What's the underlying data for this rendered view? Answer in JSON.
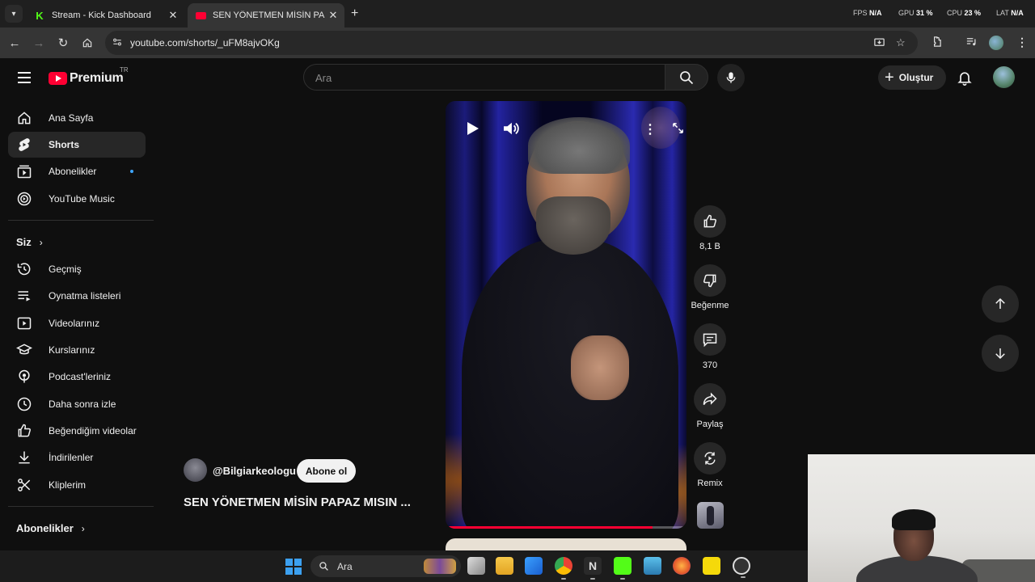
{
  "browser": {
    "tabs": [
      {
        "title": "Stream - Kick Dashboard",
        "active": false
      },
      {
        "title": "SEN YÖNETMEN MİSİN PAPAZ MISIN",
        "active": true
      }
    ],
    "close_glyph": "✕",
    "new_tab_glyph": "+",
    "url": "youtube.com/shorts/_uFM8ajvOKg",
    "hud": {
      "fps_label": "FPS",
      "fps_value": "N/A",
      "gpu_label": "GPU",
      "gpu_value": "31 %",
      "cpu_label": "CPU",
      "cpu_value": "23 %",
      "lat_label": "LAT",
      "lat_value": "N/A"
    }
  },
  "masthead": {
    "logo_text": "Premium",
    "region": "TR",
    "search_placeholder": "Ara",
    "create_label": "Oluştur"
  },
  "sidebar": {
    "primary": [
      {
        "label": "Ana Sayfa",
        "icon": "home-icon"
      },
      {
        "label": "Shorts",
        "icon": "shorts-icon",
        "active": true
      },
      {
        "label": "Abonelikler",
        "icon": "subscriptions-icon",
        "dot": true
      },
      {
        "label": "YouTube Music",
        "icon": "music-icon"
      }
    ],
    "you_heading": "Siz",
    "you_items": [
      {
        "label": "Geçmiş",
        "icon": "history-icon"
      },
      {
        "label": "Oynatma listeleri",
        "icon": "playlist-icon"
      },
      {
        "label": "Videolarınız",
        "icon": "your-videos-icon"
      },
      {
        "label": "Kurslarınız",
        "icon": "courses-icon"
      },
      {
        "label": "Podcast'leriniz",
        "icon": "podcast-icon"
      },
      {
        "label": "Daha sonra izle",
        "icon": "watch-later-icon"
      },
      {
        "label": "Beğendiğim videolar",
        "icon": "liked-icon"
      },
      {
        "label": "İndirilenler",
        "icon": "download-icon"
      },
      {
        "label": "Kliplerim",
        "icon": "clips-icon"
      }
    ],
    "subs_heading": "Abonelikler",
    "chevron": "›"
  },
  "short": {
    "channel": "@Bilgiarkeologu",
    "subscribe_label": "Abone ol",
    "title": "SEN YÖNETMEN MİSİN PAPAZ MISIN ...",
    "progress": 0.86,
    "actions": {
      "like_count": "8,1 B",
      "dislike_label": "Beğenme",
      "comment_count": "370",
      "share_label": "Paylaş",
      "remix_label": "Remix"
    }
  },
  "taskbar": {
    "search_label": "Ara"
  },
  "colors": {
    "accent": "#ff0033",
    "link_dot": "#3ea6ff",
    "kick_green": "#53fc18"
  }
}
